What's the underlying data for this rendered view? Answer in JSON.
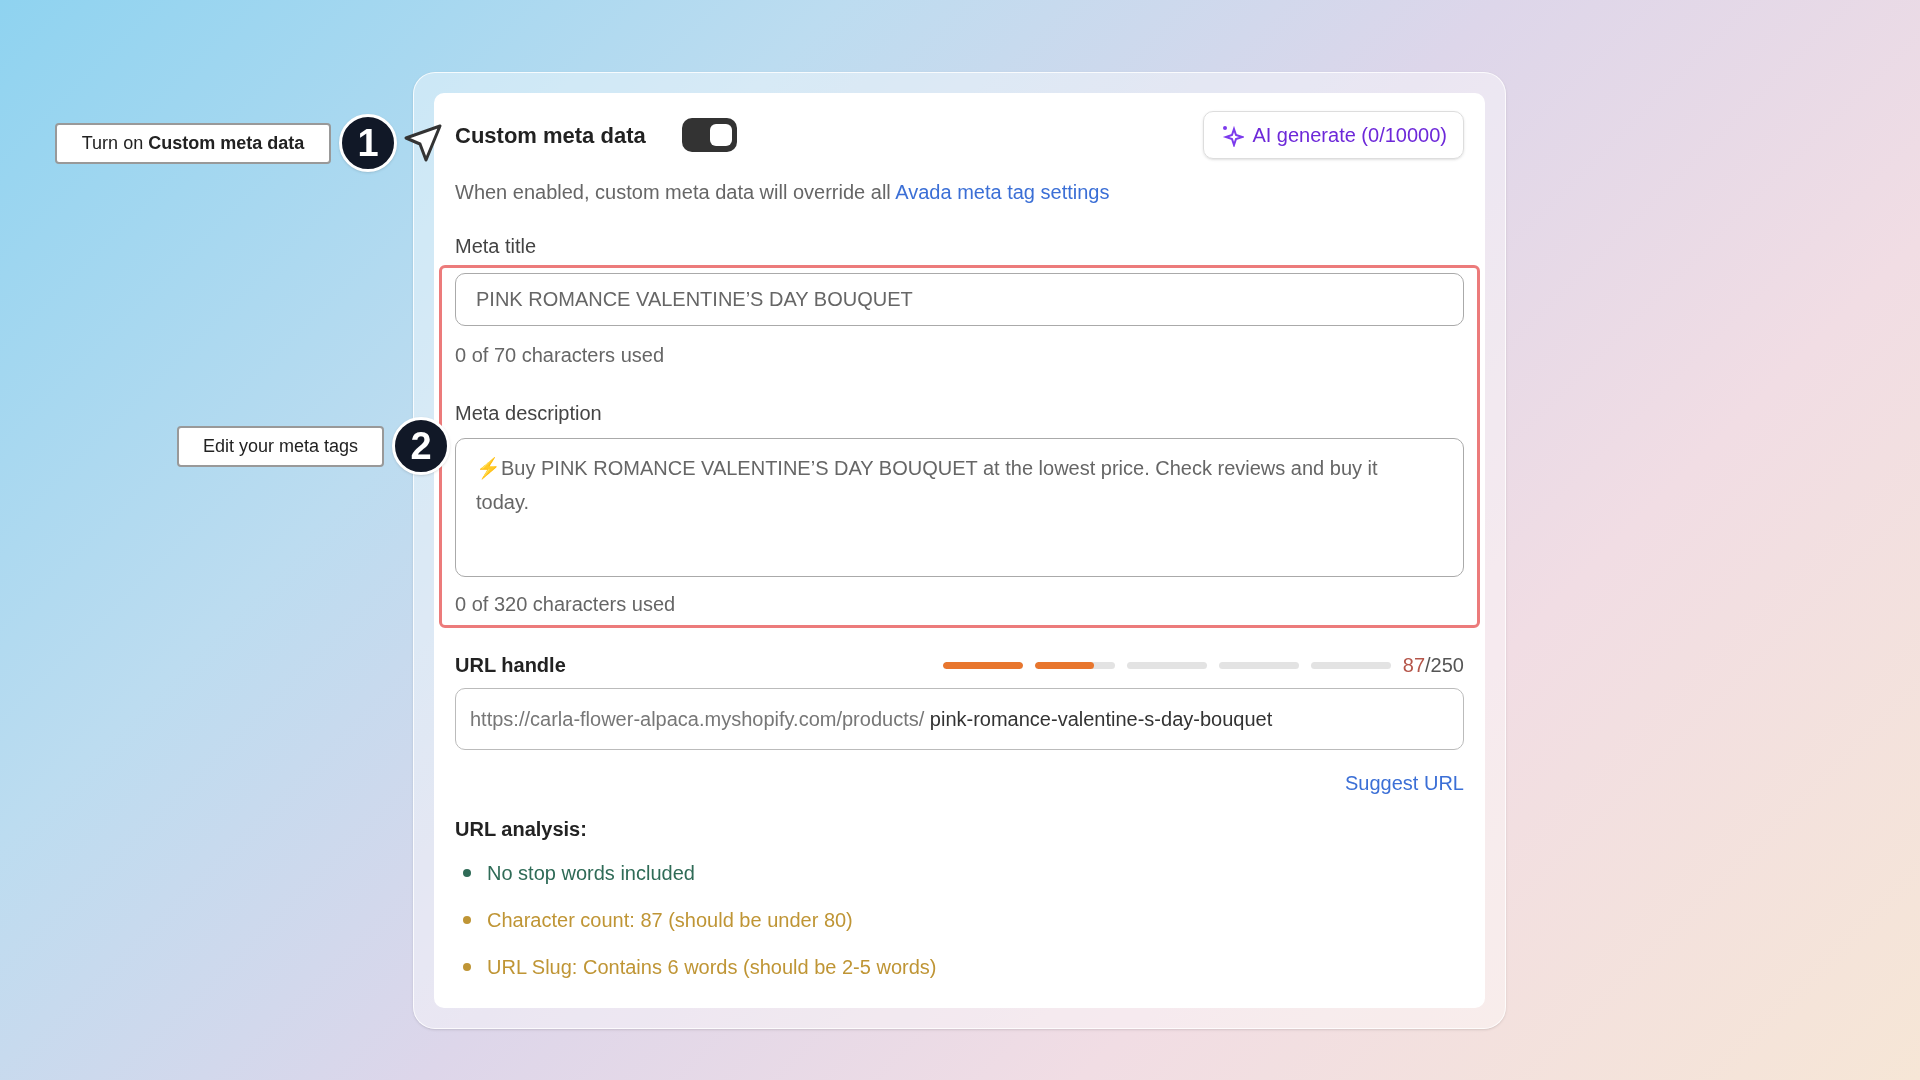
{
  "callouts": [
    {
      "number": "1",
      "label": "Turn on **Custom meta data**"
    },
    {
      "number": "2",
      "label": "Edit your meta tags"
    }
  ],
  "header": {
    "title": "Custom meta data",
    "toggle": {
      "on": true
    },
    "ai_button": "AI generate (0/10000)"
  },
  "description": {
    "text": "When enabled, custom meta data will override all",
    "link": "Avada meta tag settings"
  },
  "meta_title": {
    "label": "Meta title",
    "placeholder": "PINK ROMANCE VALENTINE’S DAY BOUQUET",
    "counter": "0 of 70 characters used"
  },
  "meta_description": {
    "label": "Meta description",
    "placeholder": "⚡Buy PINK ROMANCE VALENTINE’S DAY BOUQUET at the lowest price. Check reviews and buy it today.",
    "counter": "0 of 320 characters used"
  },
  "url_handle": {
    "label": "URL handle",
    "segments": [
      {
        "level": 1
      },
      {
        "level": 0.74
      },
      {
        "level": 0
      },
      {
        "level": 0
      },
      {
        "level": 0
      }
    ],
    "count": "87",
    "limit": "/250",
    "prefix": "https://carla-flower-alpaca.myshopify.com/products/",
    "value": "pink-romance-valentine-s-day-bouquet",
    "suggest_link": "Suggest URL"
  },
  "url_analysis": {
    "title": "URL analysis:",
    "items": [
      {
        "kind": "pass",
        "text": "No stop words included"
      },
      {
        "kind": "warning",
        "text": "Character count: 87 (should be under 80)"
      },
      {
        "kind": "warning",
        "text": "URL Slug: Contains 6 words (should be 2-5 words)"
      }
    ]
  }
}
